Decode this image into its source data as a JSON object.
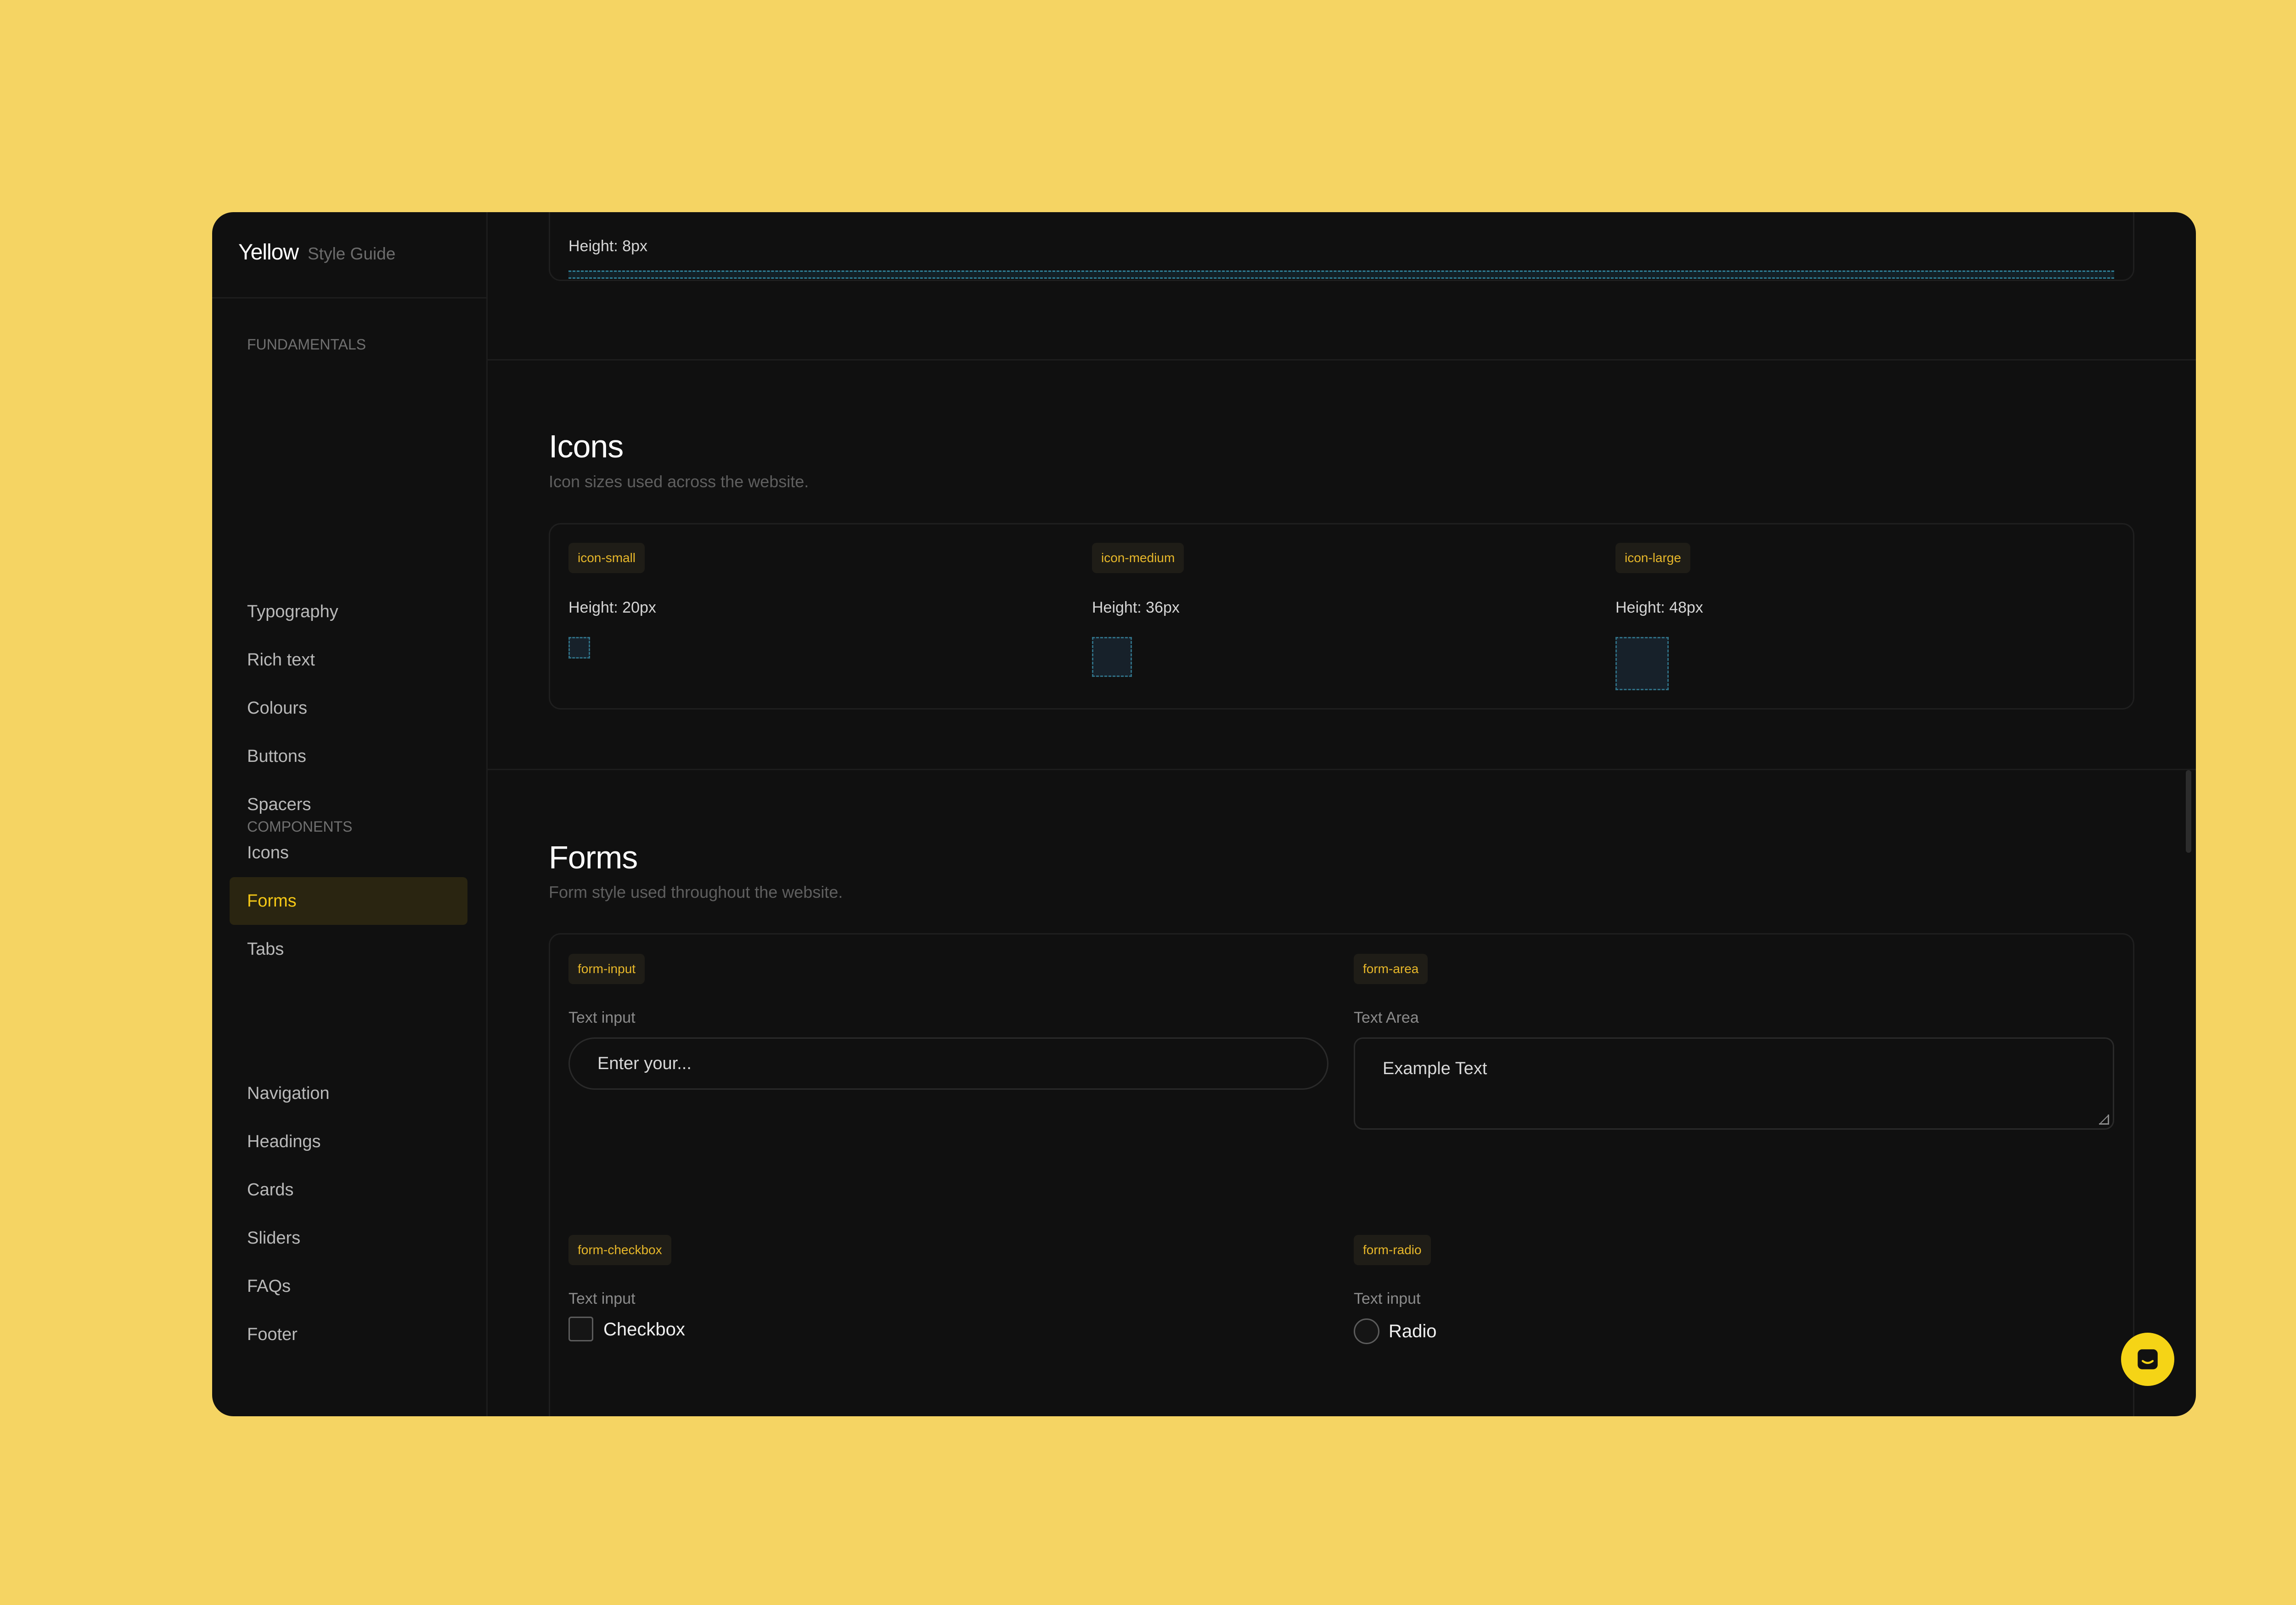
{
  "brand": {
    "name": "Yellow",
    "subtitle": "Style Guide"
  },
  "sidebar": {
    "fundamentals_title": "FUNDAMENTALS",
    "fundamentals": [
      {
        "label": "Typography"
      },
      {
        "label": "Rich text"
      },
      {
        "label": "Colours"
      },
      {
        "label": "Buttons"
      },
      {
        "label": "Spacers"
      },
      {
        "label": "Icons"
      },
      {
        "label": "Forms",
        "active": true
      },
      {
        "label": "Tabs"
      }
    ],
    "components_title": "COMPONENTS",
    "components": [
      {
        "label": "Navigation"
      },
      {
        "label": "Headings"
      },
      {
        "label": "Cards"
      },
      {
        "label": "Sliders"
      },
      {
        "label": "FAQs"
      },
      {
        "label": "Footer"
      }
    ]
  },
  "spacer": {
    "height_label": "Height: 8px"
  },
  "icons": {
    "title": "Icons",
    "subtitle": "Icon sizes used across the website.",
    "items": [
      {
        "tag": "icon-small",
        "height_label": "Height: 20px"
      },
      {
        "tag": "icon-medium",
        "height_label": "Height: 36px"
      },
      {
        "tag": "icon-large",
        "height_label": "Height: 48px"
      }
    ]
  },
  "forms": {
    "title": "Forms",
    "subtitle": "Form style used throughout the website.",
    "input": {
      "tag": "form-input",
      "label": "Text input",
      "placeholder": "Enter your..."
    },
    "area": {
      "tag": "form-area",
      "label": "Text Area",
      "value": "Example Text"
    },
    "checkbox": {
      "tag": "form-checkbox",
      "label": "Text input",
      "control_label": "Checkbox",
      "checked": false
    },
    "radio": {
      "tag": "form-radio",
      "label": "Text input",
      "control_label": "Radio",
      "checked": false
    }
  },
  "colors": {
    "background": "#F5D463",
    "window": "#101010",
    "accent": "#F5C816",
    "dashed": "#2f7f96"
  },
  "chat": {
    "icon": "chat-icon"
  }
}
